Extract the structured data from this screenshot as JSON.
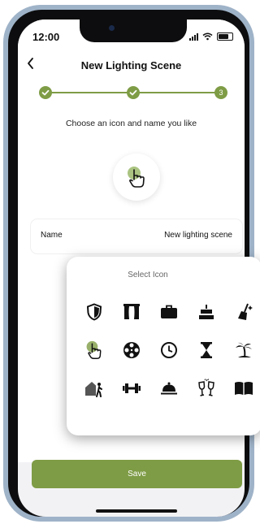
{
  "status_bar": {
    "time": "12:00"
  },
  "header": {
    "title": "New Lighting Scene",
    "back_icon": "chevron-left-icon"
  },
  "stepper": {
    "steps": [
      {
        "state": "done",
        "icon": "check-icon"
      },
      {
        "state": "done",
        "icon": "check-icon"
      },
      {
        "state": "current",
        "label": "3"
      }
    ]
  },
  "subtitle": "Choose an icon and name you like",
  "selected_icon": "hand-pointer-icon",
  "name_field": {
    "label": "Name",
    "value": "New lighting scene"
  },
  "popup": {
    "title": "Select Icon",
    "icons": [
      "shield-icon",
      "theater-icon",
      "briefcase-icon",
      "cake-icon",
      "broom-icon",
      "hand-pointer-icon",
      "film-reel-icon",
      "clock-icon",
      "hourglass-icon",
      "beach-icon",
      "home-walk-icon",
      "dumbbell-icon",
      "cloche-icon",
      "champagne-icon",
      "book-icon"
    ],
    "selected_index": 5
  },
  "footer": {
    "save_label": "Save"
  },
  "colors": {
    "accent": "#7e9c45",
    "text": "#111111",
    "muted": "#666666"
  }
}
